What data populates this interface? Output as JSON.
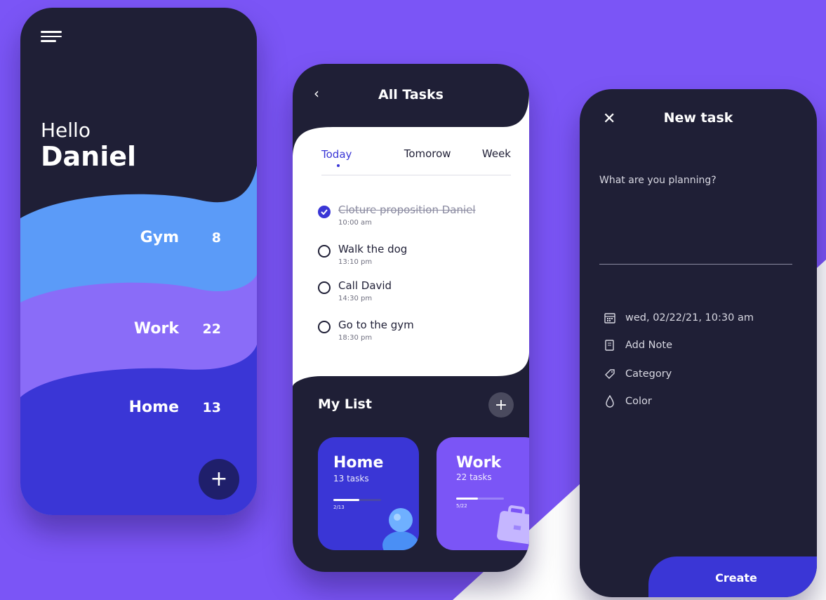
{
  "colors": {
    "background": "#7b55f6",
    "dark": "#1f1f36",
    "gym": "#5b9bf8",
    "work": "#8a6cf8",
    "home": "#3a36d6",
    "accent": "#3a36d6"
  },
  "screen_home": {
    "menu_icon": "menu-icon",
    "greeting": "Hello",
    "user_name": "Daniel",
    "categories": [
      {
        "label": "Gym",
        "count": "8"
      },
      {
        "label": "Work",
        "count": "22"
      },
      {
        "label": "Home",
        "count": "13"
      }
    ],
    "fab_label": "+"
  },
  "screen_tasks": {
    "title": "All Tasks",
    "back_icon": "chevron-left-icon",
    "tabs": [
      {
        "label": "Today",
        "active": true
      },
      {
        "label": "Tomorow"
      },
      {
        "label": "Week"
      }
    ],
    "tasks": [
      {
        "title": "Cloture proposition Daniel",
        "time": "10:00 am",
        "done": true
      },
      {
        "title": "Walk the dog",
        "time": "13:10 pm",
        "done": false
      },
      {
        "title": "Call David",
        "time": "14:30 pm",
        "done": false
      },
      {
        "title": "Go to the gym",
        "time": "18:30 pm",
        "done": false
      }
    ],
    "my_list_title": "My List",
    "add_label": "+",
    "lists": [
      {
        "title": "Home",
        "subtitle": "13 tasks",
        "progress": "2/13",
        "fraction": 0.55
      },
      {
        "title": "Work",
        "subtitle": "22 tasks",
        "progress": "5/22",
        "fraction": 0.45
      }
    ]
  },
  "screen_new": {
    "title": "New task",
    "close_label": "✕",
    "prompt": "What are you planning?",
    "options": [
      {
        "label": "wed, 02/22/21, 10:30 am",
        "icon": "calendar-icon"
      },
      {
        "label": "Add Note",
        "icon": "note-icon"
      },
      {
        "label": "Category",
        "icon": "tag-icon"
      },
      {
        "label": "Color",
        "icon": "drop-icon"
      }
    ],
    "create_label": "Create"
  }
}
